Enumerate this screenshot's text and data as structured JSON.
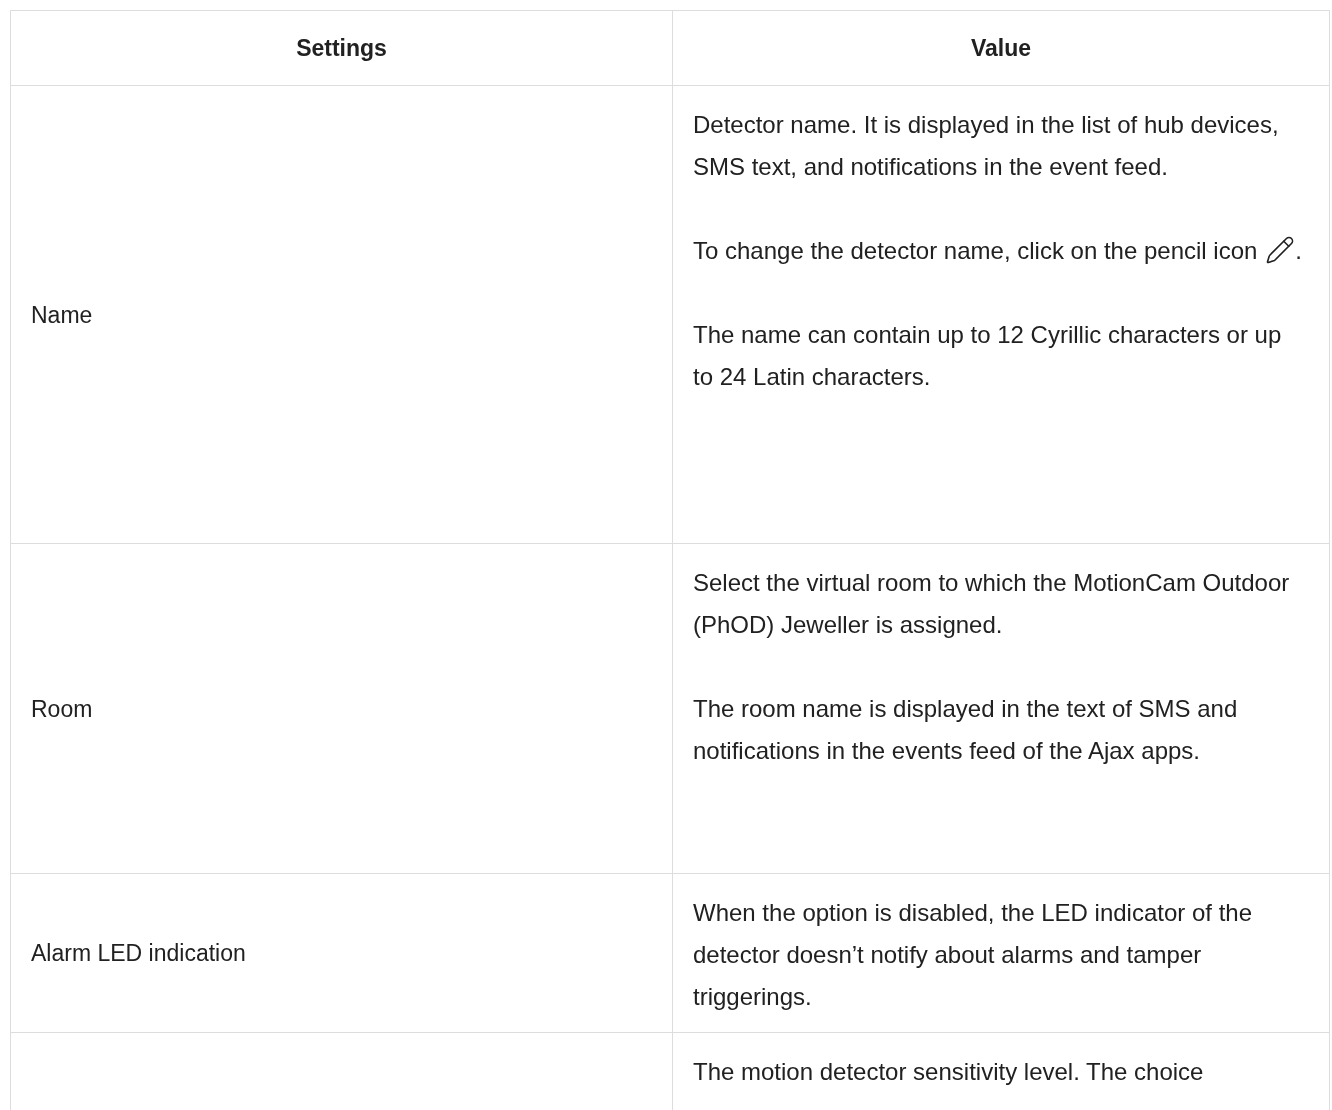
{
  "table": {
    "columns": [
      "Settings",
      "Value"
    ],
    "rows": [
      {
        "setting": "Name",
        "paragraphs": [
          {
            "text": "Detector name. It is displayed in the list of hub devices, SMS text, and notifications in the event feed."
          },
          {
            "text": "To change the detector name, click on the pencil icon",
            "kind": "with_icon",
            "after": "."
          },
          {
            "text": "The name can contain up to 12 Cyrillic characters or up to 24 Latin characters."
          }
        ]
      },
      {
        "setting": "Room",
        "paragraphs": [
          {
            "text": "Select the virtual room to which the MotionCam Outdoor (PhOD) Jeweller is assigned."
          },
          {
            "text": "The room name is displayed in the text of SMS and notifications in the events feed of the Ajax apps."
          }
        ]
      },
      {
        "setting": "Alarm LED indication",
        "paragraphs": [
          {
            "text": "When the option is disabled, the LED indicator of the detector doesn’t notify about alarms and tamper triggerings."
          }
        ]
      },
      {
        "setting": "",
        "paragraphs": [
          {
            "text": "The motion detector sensitivity level. The choice"
          }
        ]
      }
    ]
  }
}
